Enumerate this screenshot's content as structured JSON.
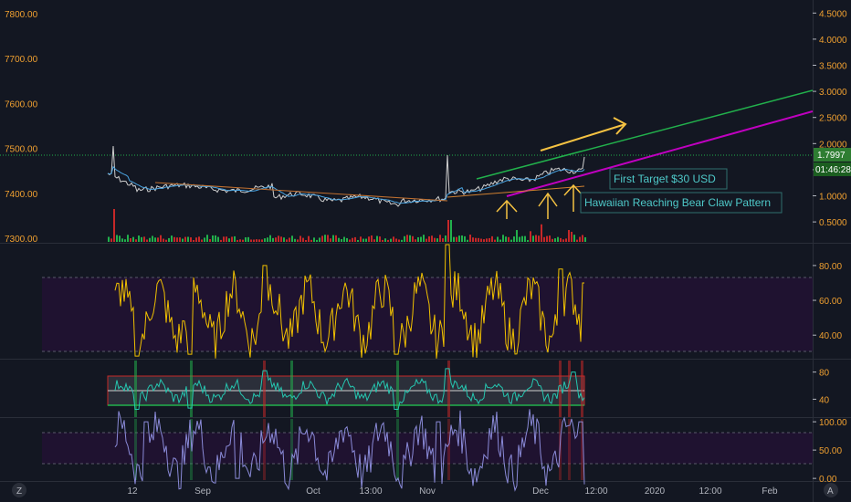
{
  "chart_data": [
    {
      "type": "candlestick",
      "pane": "price",
      "left_axis_ticks": [
        "7800.00",
        "7700.00",
        "7600.00",
        "7500.00",
        "7400.00",
        "7300.00"
      ],
      "left_axis_values": [
        7800,
        7700,
        7600,
        7500,
        7400,
        7300
      ],
      "right_axis_ticks": [
        "4.5000",
        "4.0000",
        "3.5000",
        "3.0000",
        "2.5000",
        "2.0000",
        "1.5000",
        "1.0000",
        "0.5000"
      ],
      "right_axis_values": [
        4.5,
        4.0,
        3.5,
        3.0,
        2.5,
        2.0,
        1.5,
        1.0,
        0.5
      ],
      "ylim_left": [
        7290,
        7830
      ],
      "ylim_right": [
        0.1,
        4.75
      ],
      "price_line": 7500,
      "last_value_label": "1.7997",
      "countdown_label": "01:46:28",
      "annotations": [
        "First Target $30 USD",
        "Hawaiian Reaching Bear Claw Pattern"
      ]
    },
    {
      "type": "line",
      "pane": "oscillator-1",
      "axis_ticks": [
        "80.00",
        "60.00",
        "40.00"
      ],
      "axis_values": [
        80,
        60,
        40
      ],
      "ylim": [
        27,
        92
      ],
      "band": [
        30,
        70
      ]
    },
    {
      "type": "line",
      "pane": "oscillator-2",
      "axis_ticks": [
        "80",
        "40"
      ],
      "axis_values": [
        80,
        40
      ],
      "ylim": [
        15,
        97
      ],
      "band": [
        30,
        70
      ]
    },
    {
      "type": "line",
      "pane": "oscillator-3",
      "axis_ticks": [
        "100.00",
        "50.00",
        "0.00"
      ],
      "axis_values": [
        100,
        50,
        0
      ],
      "ylim": [
        -3,
        105
      ],
      "band": [
        20,
        80
      ]
    }
  ],
  "time_axis": {
    "labels": [
      "12",
      "Sep",
      "Oct",
      "13:00",
      "Nov",
      "Dec",
      "12:00",
      "2020",
      "12:00",
      "Feb"
    ],
    "time_label": "12:00"
  },
  "buttons": {
    "left_corner": "Z",
    "right_corner": "A"
  },
  "colors": {
    "background": "#131722",
    "axis_text": "#f0a030",
    "green_channel": "#22b14c",
    "magenta_channel": "#c000c0",
    "yellow_arrow": "#f5c242",
    "oscillator_yellow": "#f0c000",
    "oscillator_teal": "#26c6b0",
    "band_fill": "#1f1230",
    "badge_green": "#2e7d32"
  }
}
